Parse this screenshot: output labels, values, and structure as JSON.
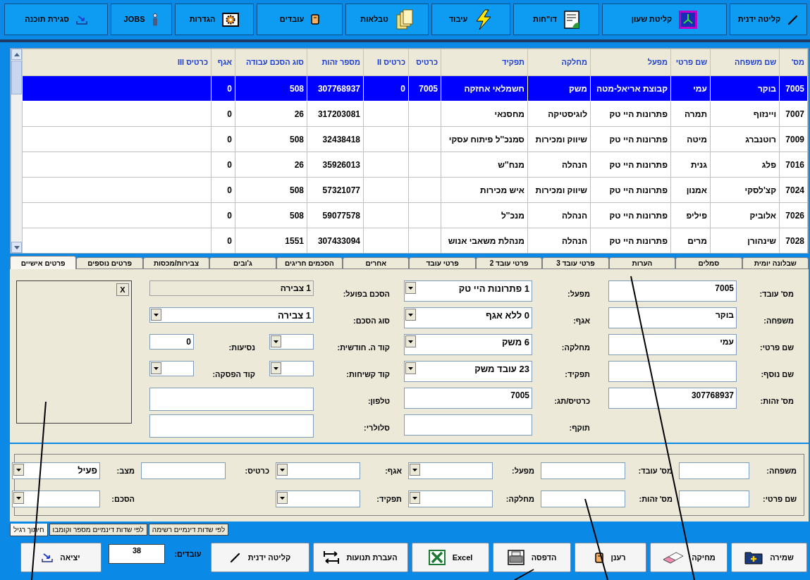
{
  "toolbar": [
    {
      "label": "קליטה ידנית",
      "kind": "pen"
    },
    {
      "label": "קליטת שעון",
      "kind": "clock"
    },
    {
      "label": "דו\"חות",
      "kind": "report"
    },
    {
      "label": "עיבוד",
      "kind": "bolt"
    },
    {
      "label": "טבלאות",
      "kind": "folders"
    },
    {
      "label": "עובדים",
      "kind": "card"
    },
    {
      "label": "הגדרות",
      "kind": "gear"
    },
    {
      "label": "JOBS",
      "kind": "person"
    },
    {
      "label": "סגירת תוכנה",
      "kind": "exit"
    }
  ],
  "table": {
    "columns": [
      "מס'",
      "שם משפחה",
      "שם פרטי",
      "מפעל",
      "מחלקה",
      "תפקיד",
      "כרטיס",
      "כרטיס II",
      "מספר זהות",
      "סוג הסכם עבודה",
      "אגף",
      "כרטיס III"
    ],
    "rows": [
      {
        "selected": true,
        "cells": [
          "7005",
          "בוקר",
          "עמי",
          "קבוצת אריאל-מטה",
          "משק",
          "חשמלאי אחזקה",
          "7005",
          "0",
          "307768937",
          "508",
          "0",
          null
        ]
      },
      {
        "selected": false,
        "cells": [
          "7007",
          "ויינזוף",
          "תמרה",
          "פתרונות היי טק",
          "לוגיסטיקה",
          "מחסנאי",
          null,
          null,
          "317203081",
          "26",
          "0",
          null
        ]
      },
      {
        "selected": false,
        "cells": [
          "7009",
          "רוטנברג",
          "מיטה",
          "פתרונות היי טק",
          "שיווק ומכירות",
          "סמנכ''ל פיתוח עסקי",
          null,
          null,
          "32438418",
          "508",
          "0",
          null
        ]
      },
      {
        "selected": false,
        "cells": [
          "7016",
          "פלג",
          "גנית",
          "פתרונות היי טק",
          "הנהלה",
          "מנח''ש",
          null,
          null,
          "35926013",
          "26",
          "0",
          null
        ]
      },
      {
        "selected": false,
        "cells": [
          "7024",
          "קצ'לסקי",
          "אמנון",
          "פתרונות היי טק",
          "שיווק ומכירות",
          "איש מכירות",
          null,
          null,
          "57321077",
          "508",
          "0",
          null
        ]
      },
      {
        "selected": false,
        "cells": [
          "7026",
          "אלוביק",
          "פיליפ",
          "פתרונות היי טק",
          "הנהלה",
          "מנכ''ל",
          null,
          null,
          "59077578",
          "508",
          "0",
          null
        ]
      },
      {
        "selected": false,
        "cells": [
          "7028",
          "שינהורן",
          "מרים",
          "פתרונות היי טק",
          "הנהלה",
          "מנהלת משאבי אנוש",
          null,
          null,
          "307433094",
          "1551",
          "0",
          null
        ]
      }
    ]
  },
  "tabs": [
    {
      "label": "שבלונה יומית",
      "selected": false
    },
    {
      "label": "סמלים",
      "selected": false
    },
    {
      "label": "הערות",
      "selected": false
    },
    {
      "label": "פרטי עובד 3",
      "selected": false
    },
    {
      "label": "פרטי עובד 2",
      "selected": false
    },
    {
      "label": "פרטי עובד",
      "selected": false
    },
    {
      "label": "אחרים",
      "selected": false
    },
    {
      "label": "הסכמים חריגים",
      "selected": false
    },
    {
      "label": "ג'ובים",
      "selected": false
    },
    {
      "label": "צבירות/מכסות",
      "selected": false
    },
    {
      "label": "פרטים נוספים",
      "selected": false
    },
    {
      "label": "פרטים אישיים",
      "selected": true
    }
  ],
  "form": {
    "column_1": [
      {
        "label": "מס' עובד:",
        "kind": "text",
        "value": "7005"
      },
      {
        "label": "משפחה:",
        "kind": "text",
        "value": "בוקר"
      },
      {
        "label": "שם פרטי:",
        "kind": "text",
        "value": "עמי"
      },
      {
        "label": "שם נוסף:",
        "kind": "text"
      },
      {
        "label": "מס' זהות:",
        "kind": "text",
        "value": "307768937"
      }
    ],
    "column_2": [
      {
        "label": "מפעל:",
        "kind": "combo",
        "value": "1 פתרונות היי טק"
      },
      {
        "label": "אגף:",
        "kind": "combo",
        "value": "0 ללא אגף"
      },
      {
        "label": "מחלקה:",
        "kind": "combo",
        "value": "6  משק"
      },
      {
        "label": "תפקיד:",
        "kind": "combo",
        "value": "23 עובד משק"
      },
      {
        "label": "כרטיס/תג:",
        "kind": "text",
        "value": "7005"
      },
      {
        "label": "תוקף:",
        "kind": "text"
      }
    ],
    "column_3": [
      [
        {
          "label": "הסכם בפועל:",
          "kind": "readonly",
          "value": "1 צבירה"
        }
      ],
      [
        {
          "label": "סוג הסכם:",
          "kind": "combo",
          "value": "1 צבירה"
        }
      ],
      [
        {
          "label": "קוד ה. חודשית:",
          "kind": "combo"
        },
        {
          "label": "נסיעות:",
          "kind": "text",
          "value": "0"
        }
      ],
      [
        {
          "label": "קוד קשיחות:",
          "kind": "combo"
        },
        {
          "label": "קוד הפסקה:",
          "kind": "combo"
        }
      ],
      [
        {
          "label": "טלפון:",
          "kind": "text"
        }
      ],
      [
        {
          "label": "סלולרי:",
          "kind": "text"
        }
      ]
    ],
    "photo": {
      "close_label": "X"
    }
  },
  "filter": {
    "rows": [
      [
        {
          "label": "משפחה:",
          "kind": "text"
        },
        {
          "label": "מס' עובד:",
          "kind": "text"
        },
        {
          "label": "מפעל:",
          "kind": "combo"
        },
        {
          "label": "אגף:",
          "kind": "combo"
        },
        {
          "label": "כרטיס:",
          "kind": "text"
        },
        {
          "label": "מצב:",
          "kind": "combo",
          "value": "פעיל"
        }
      ],
      [
        {
          "label": "שם פרטי:",
          "kind": "text"
        },
        {
          "label": "מס' זהות:",
          "kind": "text"
        },
        {
          "label": "מחלקה:",
          "kind": "combo"
        },
        {
          "label": "תפקיד:",
          "kind": "combo"
        },
        {
          "kind": "blank"
        },
        {
          "label": "הסכם:",
          "kind": "combo"
        }
      ]
    ],
    "tabs": [
      {
        "label": "לפי שדות דינמיים רשימה",
        "selected": false
      },
      {
        "label": "לפי שדות דינמיים מספר וקומבו",
        "selected": false
      },
      {
        "label": "חיתוך רגיל",
        "selected": true
      }
    ]
  },
  "bottom_bar": {
    "buttons": [
      {
        "label": "שמירה",
        "kind": "save"
      },
      {
        "label": "מחיקה",
        "kind": "eraser"
      },
      {
        "label": "רענן",
        "kind": "card"
      },
      {
        "label": "הדפסה",
        "kind": "printer"
      },
      {
        "label": "Excel",
        "kind": "excel"
      },
      {
        "label": "העברת תנועות",
        "kind": "transfer"
      },
      {
        "label": "קליטה ידנית",
        "kind": "pen"
      }
    ],
    "employee_count": {
      "label": "עובדים:",
      "value": "38"
    },
    "exit_button": {
      "label": "יציאה",
      "kind": "exit"
    }
  }
}
